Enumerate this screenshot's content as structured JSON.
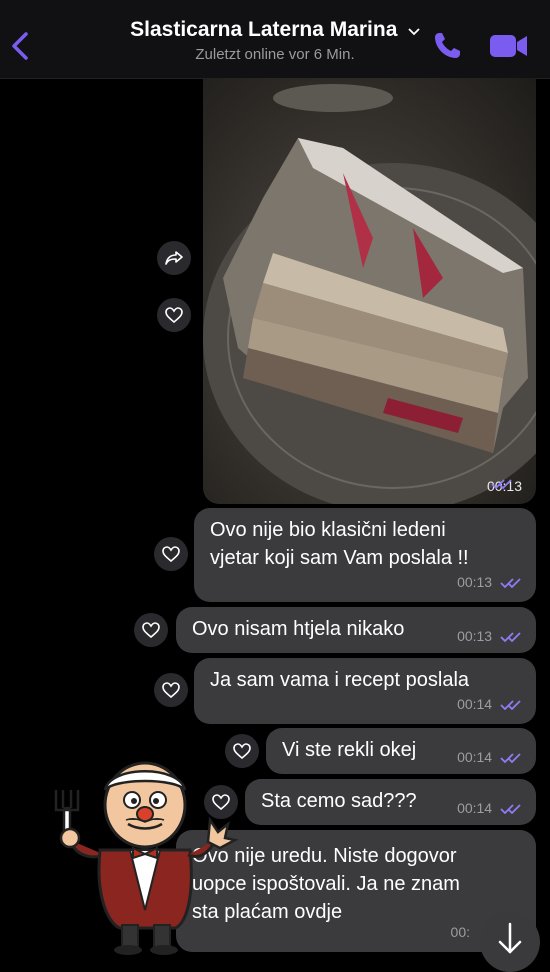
{
  "header": {
    "title": "Slasticarna Laterna Marina",
    "status": "Zuletzt online vor 6 Min."
  },
  "colors": {
    "accent": "#7b5cf0",
    "bubble": "#3b3b3e",
    "background": "#000000"
  },
  "photo_message": {
    "time": "00:13",
    "read_icon": "double-check-icon"
  },
  "messages": [
    {
      "text": "Ovo nije bio klasični ledeni\nvjetar koji sam Vam poslala !!",
      "time": "00:13"
    },
    {
      "text": "Ovo nisam htjela nikako",
      "time": "00:13"
    },
    {
      "text": "Ja sam vama i recept poslala",
      "time": "00:14"
    },
    {
      "text": "Vi ste rekli okej",
      "time": "00:14"
    },
    {
      "text": "Sta cemo sad???",
      "time": "00:14"
    },
    {
      "text": "Ovo nije uredu. Niste dogovor\nuopce ispoštovali. Ja ne znam\nsta  plaćam ovdje",
      "time": "00:"
    }
  ]
}
